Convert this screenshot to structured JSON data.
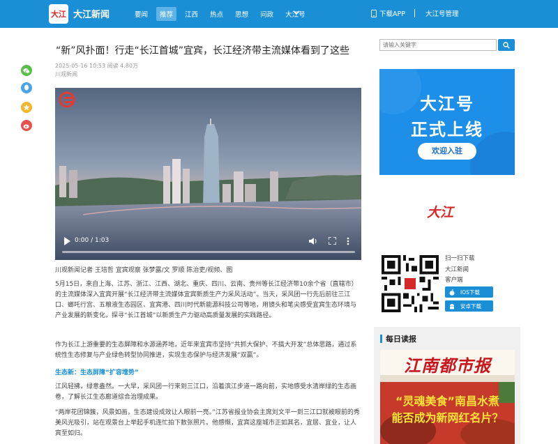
{
  "header": {
    "logo_text": "大江",
    "brand": "大江新闻",
    "nav": [
      "要闻",
      "推荐",
      "江西",
      "热点",
      "思想",
      "问政",
      "大江号"
    ],
    "active_nav": "推荐",
    "download_app": "下载APP",
    "account_manage": "大江号管理",
    "accent_color": "#1a8fd6"
  },
  "share_icons": [
    "wechat-icon",
    "qq-icon",
    "qzone-icon",
    "weibo-icon"
  ],
  "article": {
    "title": "“新”风扑面！行走“长江首城”宜宾，长江经济带主流媒体看到了这些",
    "meta": "2025-05-16 10:53 阅读 4.80万",
    "source": "川观新闻",
    "video": {
      "time": "0:00 / 1:03",
      "progress": 0
    },
    "caption": "川观新闻记者 王培哲 宜宾观察 张梦露/文 罗顺 陈治吏/视频、图",
    "paragraphs": [
      "5月15日，来自上海、江苏、浙江、江西、湖北、重庆、四川、云南、贵州等长江经济带10余个省（直辖市）的主流媒体深入宜宾开展“长江经济带主流媒体宜宾新质生产力采风活动”。当天，采风团一行先后前往三江口、螂吒行宫、五粮液生态园区、宜宾港、四川时代新能源科技公司等地，用镜头和笔尖感受宜宾生态环境与产业发展的新变化，探寻“长江首城”以新质生产力驱动高质量发展的实践路径。",
      "作为长江上游重要的生态屏障和水源涵养地，近年来宜宾市坚持“共抓大保护、不搞大开发”总体思路，通过系统性生态修复与产业绿色转型协同推进，实现生态保护与经济发展“双赢”。",
      "江风轻拂，绿意盎然。一大早，采风团一行来到三江口，沿着滨江步道一路向前，实地感受水清岸绿的生态画卷，了解长江生态廊道综合治理成果。",
      "“两岸花团锦簇，风景如画，生态建设成效让人眼前一亮。”江苏省报业协会主席刘文平一到三江口就被眼前的秀美风光吸引，站在观景台上举起手机连忙拍下数张照片。他感慨，宜宾这座城市正如其名，宜居、宜业，让人宾至如归。"
    ],
    "subheading": "生态新：生态屏障“扩容增势”"
  },
  "sidebar": {
    "search_placeholder": "请输入关键字",
    "banner": {
      "line1": "大江号",
      "line2": "正式上线",
      "button": "欢迎入驻"
    },
    "red_logo": "大江",
    "download": {
      "scan": "扫一扫下载",
      "app_name": "大江新闻",
      "client": "客户端",
      "ios": "IOS下载",
      "android": "安卓下载"
    },
    "daily": {
      "title": "每日读报",
      "paper_name": "江南都市报",
      "headline1": "“灵魂美食”南昌水煮",
      "headline2": "能否成为新网红名片？"
    }
  }
}
